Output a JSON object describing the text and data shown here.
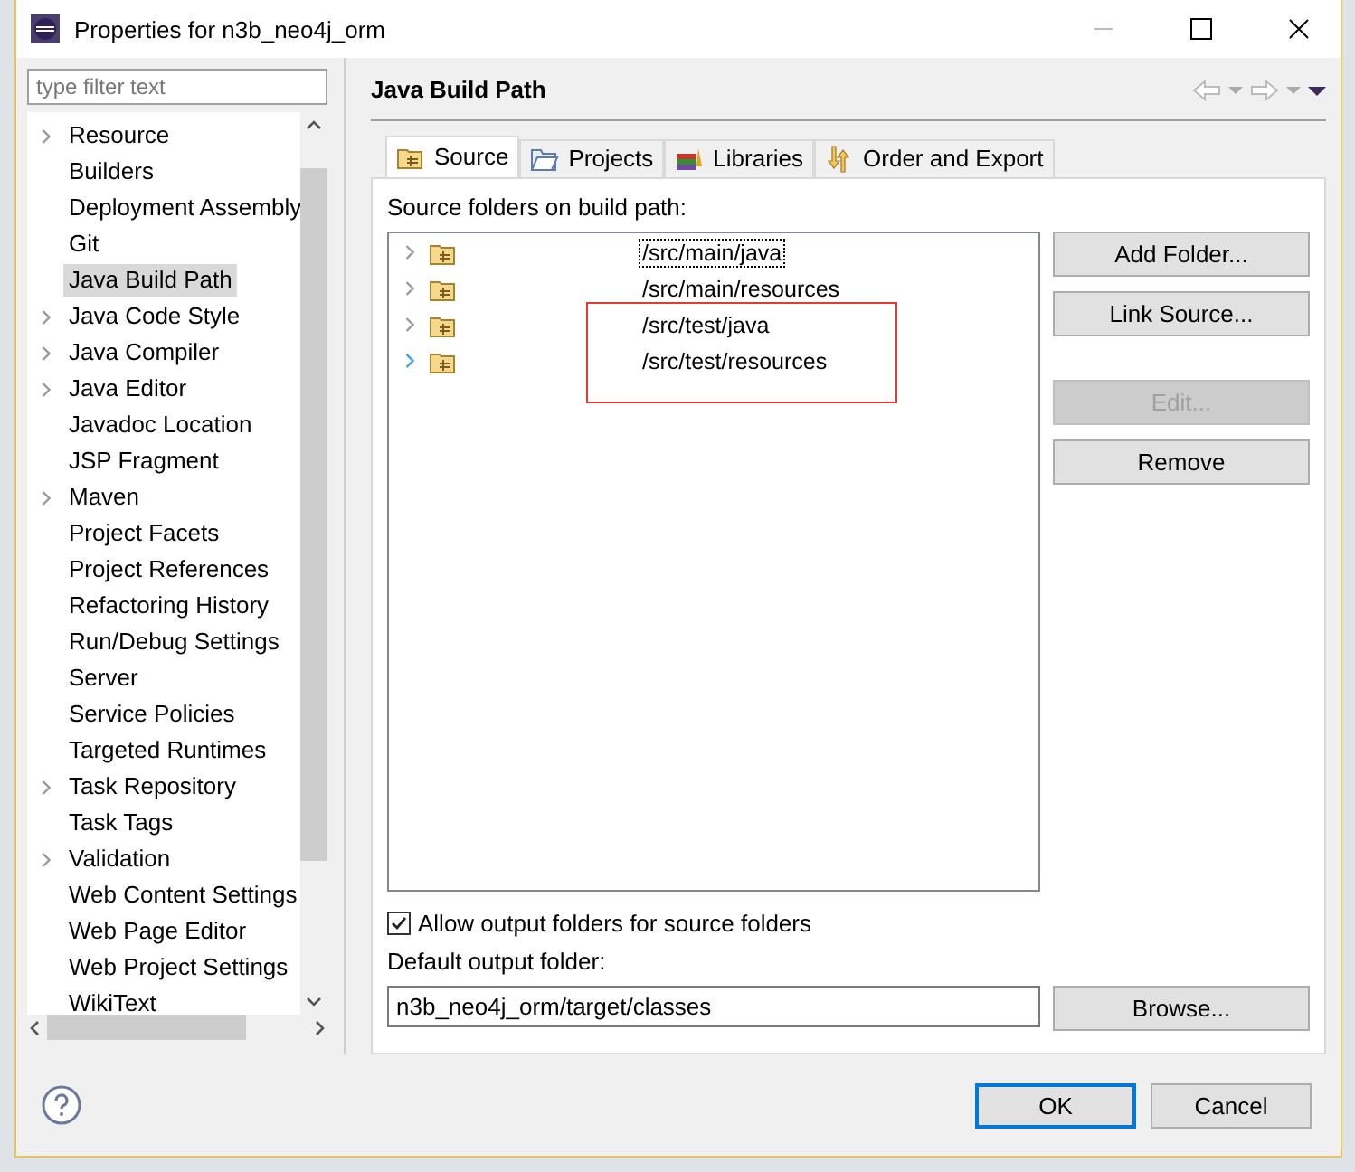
{
  "window": {
    "title": "Properties for n3b_neo4j_orm"
  },
  "filter": {
    "placeholder": "type filter text"
  },
  "sidebar": {
    "items": [
      {
        "label": "Resource",
        "expandable": true,
        "selected": false
      },
      {
        "label": "Builders",
        "expandable": false,
        "selected": false
      },
      {
        "label": "Deployment Assembly",
        "expandable": false,
        "selected": false
      },
      {
        "label": "Git",
        "expandable": false,
        "selected": false
      },
      {
        "label": "Java Build Path",
        "expandable": false,
        "selected": true
      },
      {
        "label": "Java Code Style",
        "expandable": true,
        "selected": false
      },
      {
        "label": "Java Compiler",
        "expandable": true,
        "selected": false
      },
      {
        "label": "Java Editor",
        "expandable": true,
        "selected": false
      },
      {
        "label": "Javadoc Location",
        "expandable": false,
        "selected": false
      },
      {
        "label": "JSP Fragment",
        "expandable": false,
        "selected": false
      },
      {
        "label": "Maven",
        "expandable": true,
        "selected": false
      },
      {
        "label": "Project Facets",
        "expandable": false,
        "selected": false
      },
      {
        "label": "Project References",
        "expandable": false,
        "selected": false
      },
      {
        "label": "Refactoring History",
        "expandable": false,
        "selected": false
      },
      {
        "label": "Run/Debug Settings",
        "expandable": false,
        "selected": false
      },
      {
        "label": "Server",
        "expandable": false,
        "selected": false
      },
      {
        "label": "Service Policies",
        "expandable": false,
        "selected": false
      },
      {
        "label": "Targeted Runtimes",
        "expandable": false,
        "selected": false
      },
      {
        "label": "Task Repository",
        "expandable": true,
        "selected": false
      },
      {
        "label": "Task Tags",
        "expandable": false,
        "selected": false
      },
      {
        "label": "Validation",
        "expandable": true,
        "selected": false
      },
      {
        "label": "Web Content Settings",
        "expandable": false,
        "selected": false
      },
      {
        "label": "Web Page Editor",
        "expandable": false,
        "selected": false
      },
      {
        "label": "Web Project Settings",
        "expandable": false,
        "selected": false
      },
      {
        "label": "WikiText",
        "expandable": false,
        "selected": false
      }
    ]
  },
  "page": {
    "title": "Java Build Path",
    "tabs": [
      {
        "label": "Source",
        "selected": true
      },
      {
        "label": "Projects",
        "selected": false
      },
      {
        "label": "Libraries",
        "selected": false
      },
      {
        "label": "Order and Export",
        "selected": false
      }
    ],
    "source_label": "Source folders on build path:",
    "folders": [
      {
        "path": "/src/main/java",
        "focused": true,
        "highlighted": false
      },
      {
        "path": "/src/main/resources",
        "focused": false,
        "highlighted": false
      },
      {
        "path": "/src/test/java",
        "focused": false,
        "highlighted": true
      },
      {
        "path": "/src/test/resources",
        "focused": false,
        "highlighted": true
      }
    ],
    "buttons": [
      {
        "label": "Add Folder...",
        "disabled": false
      },
      {
        "label": "Link Source...",
        "disabled": false
      },
      {
        "label": "Edit...",
        "disabled": true
      },
      {
        "label": "Remove",
        "disabled": false
      }
    ],
    "allow_output": {
      "label": "Allow output folders for source folders",
      "checked": true
    },
    "output_label": "Default output folder:",
    "output_value": "n3b_neo4j_orm/target/classes",
    "browse": "Browse..."
  },
  "footer": {
    "buttons": [
      {
        "label": "OK",
        "default": true
      },
      {
        "label": "Cancel",
        "default": false
      }
    ]
  }
}
